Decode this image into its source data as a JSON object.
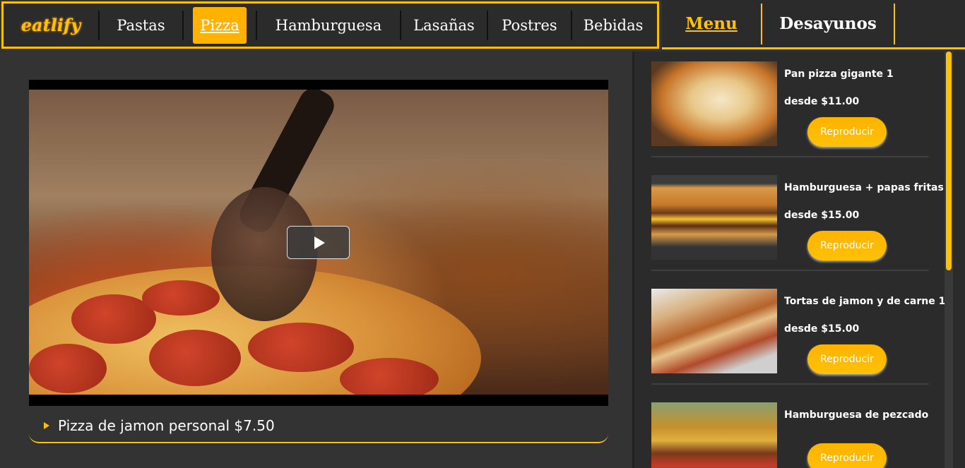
{
  "nav": {
    "brand": "eatlify",
    "items": [
      {
        "label": "Pastas",
        "active": false
      },
      {
        "label": "Pizza",
        "active": true
      },
      {
        "label": "Hamburguesa",
        "active": false
      },
      {
        "label": "Lasañas",
        "active": false
      },
      {
        "label": "Postres",
        "active": false
      },
      {
        "label": "Bebidas",
        "active": false
      }
    ]
  },
  "right_nav": {
    "menu_label": "Menu",
    "desayunos_label": "Desayunos"
  },
  "player": {
    "caption": "Pizza de jamon personal $7.50"
  },
  "sidebar": {
    "cards": [
      {
        "name": "Pan pizza gigante 1",
        "price": "desde $11.00",
        "button": "Reproducir",
        "thumb_icon": "pizza-thumbnail"
      },
      {
        "name": "Hamburguesa + papas fritas",
        "price": "desde $15.00",
        "button": "Reproducir",
        "thumb_icon": "burger-thumbnail"
      },
      {
        "name": "Tortas de jamon y de carne 1",
        "price": "desde $15.00",
        "button": "Reproducir",
        "thumb_icon": "tortas-thumbnail"
      },
      {
        "name": "Hamburguesa de pezcado",
        "price": "",
        "button": "Reproducir",
        "thumb_icon": "fish-burger-thumbnail"
      }
    ]
  },
  "colors": {
    "accent": "#ffc107",
    "background": "#333333",
    "panel": "#2b2b2b"
  }
}
